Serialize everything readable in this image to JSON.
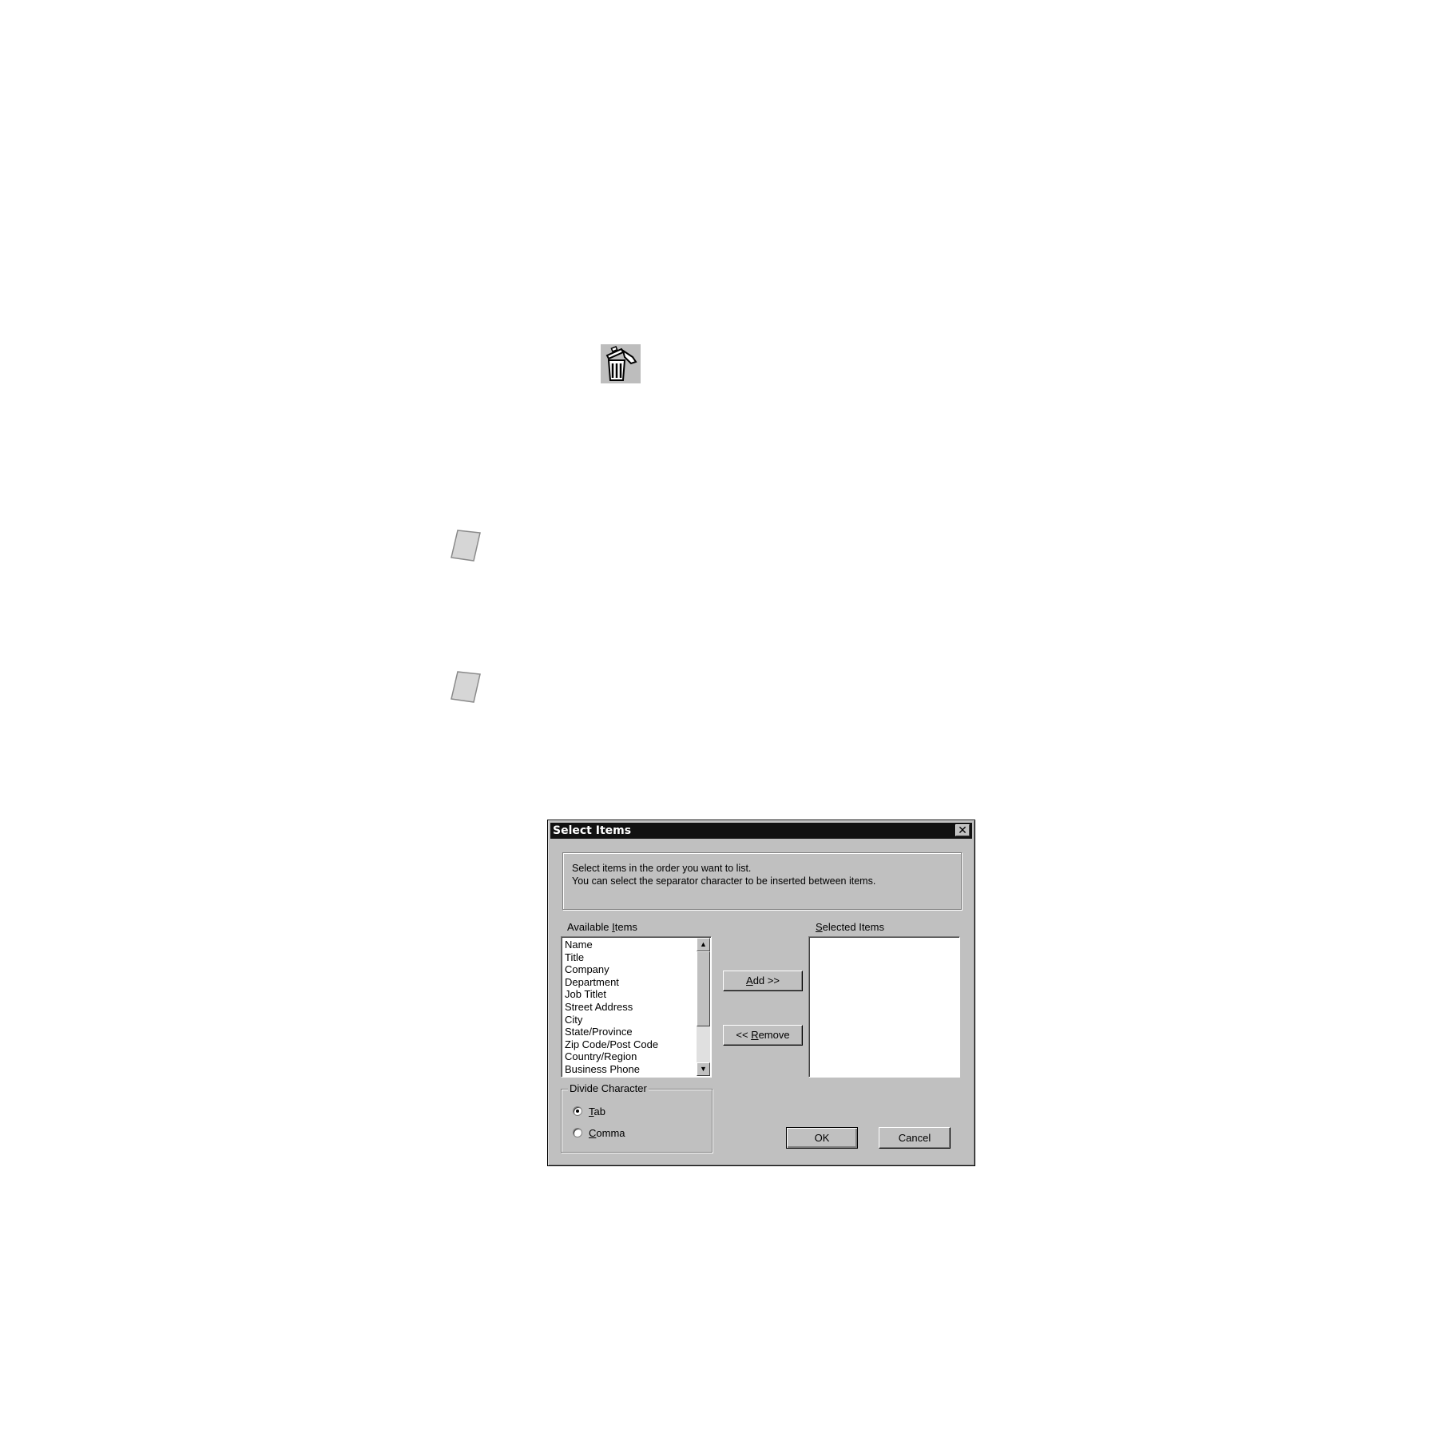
{
  "dialog": {
    "title": "Select Items",
    "close_glyph": "✕",
    "instructions": {
      "line1": "Select items in the order you want to list.",
      "line2": "You can select the separator character to be inserted between items."
    },
    "available_label": {
      "before": "Available ",
      "mnemonic": "I",
      "after": "tems"
    },
    "selected_label": {
      "before": "",
      "mnemonic": "S",
      "after": "elected Items"
    },
    "available_items": [
      "Name",
      "Title",
      "Company",
      "Department",
      "Job Titlet",
      "Street Address",
      "City",
      "State/Province",
      "Zip Code/Post Code",
      "Country/Region",
      "Business Phone"
    ],
    "add_button": {
      "before": "",
      "mnemonic": "A",
      "after": "dd >>"
    },
    "remove_button": {
      "before": "<< ",
      "mnemonic": "R",
      "after": "emove"
    },
    "divide_character": {
      "legend": "Divide Character",
      "tab": {
        "mnemonic": "T",
        "after": "ab",
        "checked": true
      },
      "comma": {
        "mnemonic": "C",
        "after": "omma",
        "checked": false
      }
    },
    "ok_label": "OK",
    "cancel_label": "Cancel"
  },
  "icons": {
    "trash": "trash-can-icon",
    "note1": "note-paper-icon",
    "note2": "note-paper-icon"
  },
  "colors": {
    "dialog_bg": "#c0c0c0",
    "titlebar": "#111111",
    "page_bg": "#ffffff"
  }
}
